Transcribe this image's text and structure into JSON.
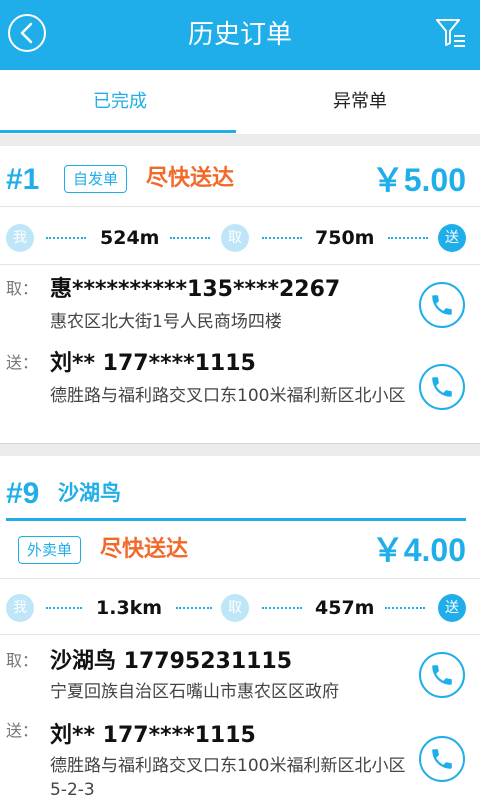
{
  "header": {
    "title": "历史订单"
  },
  "tabs": [
    {
      "label": "已完成"
    },
    {
      "label": "异常单"
    }
  ],
  "orders": [
    {
      "number": "#1",
      "type": "自发单",
      "speed": "尽快送达",
      "price": "￥5.00",
      "route": {
        "me": "我",
        "dist1": "524m",
        "pick": "取",
        "dist2": "750m",
        "deliver": "送"
      },
      "pickup": {
        "label": "取：",
        "contact": "惠**********135****2267",
        "address": "惠农区北大街1号人民商场四楼"
      },
      "dropoff": {
        "label": "送：",
        "contact": "刘** 177****1115",
        "address": "德胜路与福利路交叉口东100米福利新区北小区"
      }
    },
    {
      "number": "#9",
      "shop": "沙湖鸟",
      "type": "外卖单",
      "speed": "尽快送达",
      "price": "￥4.00",
      "route": {
        "me": "我",
        "dist1": "1.3km",
        "pick": "取",
        "dist2": "457m",
        "deliver": "送"
      },
      "pickup": {
        "label": "取：",
        "contact": "沙湖鸟 17795231115",
        "address": "宁夏回族自治区石嘴山市惠农区区政府"
      },
      "dropoff": {
        "label": "送：",
        "contact": "刘** 177****1115",
        "address": "德胜路与福利路交叉口东100米福利新区北小区5-2-3"
      }
    }
  ],
  "colors": {
    "accent": "#1faeea",
    "speed": "#f26a2b"
  }
}
